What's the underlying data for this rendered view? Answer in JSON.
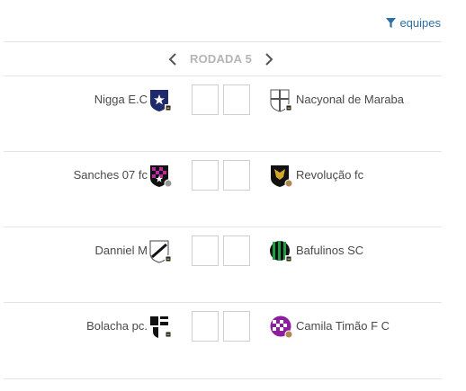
{
  "filter": {
    "label": "equipes",
    "icon": "filter-icon"
  },
  "round": {
    "label": "RODADA 5",
    "prev_icon": "chevron-left-icon",
    "next_icon": "chevron-right-icon"
  },
  "colors": {
    "accent": "#2f6fa3",
    "border": "#cfcfcf",
    "divider": "#e4e4e4",
    "muted": "#b5b5b5"
  },
  "matches": [
    {
      "home": "Nigga E.C",
      "away": "Nacyonal de Maraba",
      "home_score": "",
      "away_score": ""
    },
    {
      "home": "Sanches 07 fc",
      "away": "Revolução fc",
      "home_score": "",
      "away_score": ""
    },
    {
      "home": "Danniel M",
      "away": "Bafulinos SC",
      "home_score": "",
      "away_score": ""
    },
    {
      "home": "Bolacha pc.",
      "away": "Camila Timão F C",
      "home_score": "",
      "away_score": ""
    }
  ]
}
